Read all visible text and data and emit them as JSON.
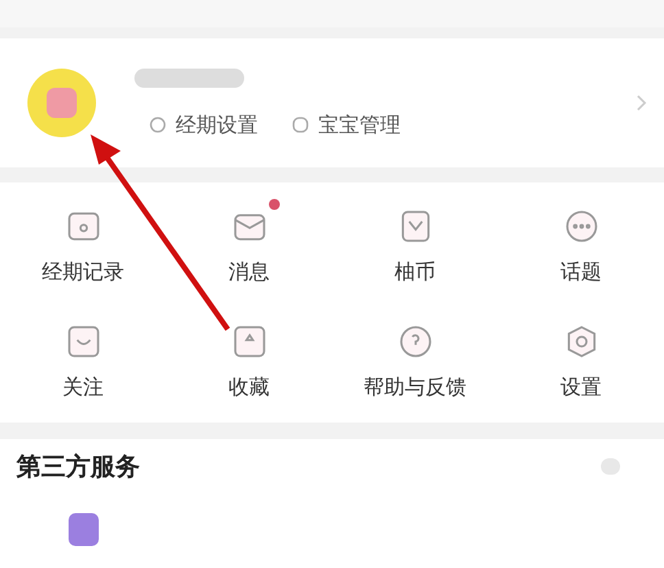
{
  "profile": {
    "links": [
      {
        "label": "经期设置"
      },
      {
        "label": "宝宝管理"
      }
    ]
  },
  "menu": [
    {
      "label": "经期记录",
      "dot": false
    },
    {
      "label": "消息",
      "dot": true
    },
    {
      "label": "柚币",
      "dot": false
    },
    {
      "label": "话题",
      "dot": false
    },
    {
      "label": "关注",
      "dot": false
    },
    {
      "label": "收藏",
      "dot": false
    },
    {
      "label": "帮助与反馈",
      "dot": false
    },
    {
      "label": "设置",
      "dot": false
    }
  ],
  "third_party": {
    "title": "第三方服务"
  }
}
